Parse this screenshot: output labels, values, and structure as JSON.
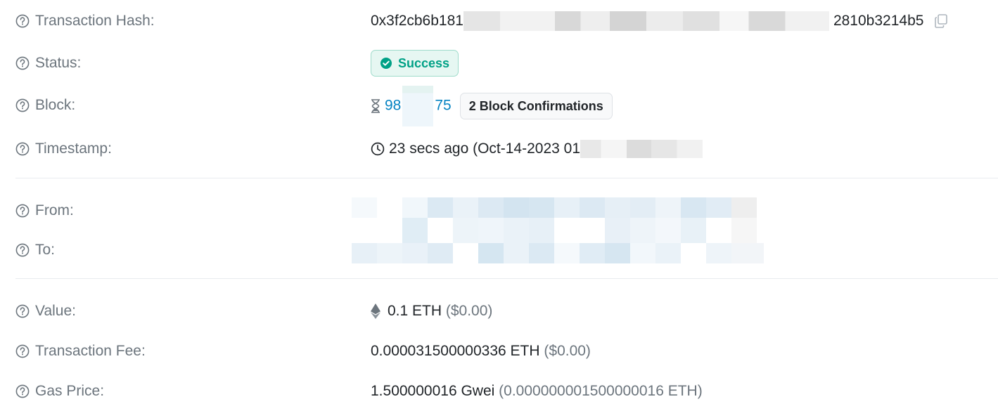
{
  "rows": {
    "hash": {
      "label": "Transaction Hash:",
      "prefix": "0x3f2cb6b181",
      "suffix": "2810b3214b5"
    },
    "status": {
      "label": "Status:",
      "value": "Success"
    },
    "block": {
      "label": "Block:",
      "prefix": "98",
      "suffix": "75",
      "confirmations": "2 Block Confirmations"
    },
    "timestamp": {
      "label": "Timestamp:",
      "value": "23 secs ago (Oct-14-2023 01"
    },
    "from": {
      "label": "From:"
    },
    "to": {
      "label": "To:"
    },
    "value": {
      "label": "Value:",
      "amount": "0.1 ETH",
      "usd": "($0.00)"
    },
    "fee": {
      "label": "Transaction Fee:",
      "amount": "0.000031500000336 ETH",
      "usd": "($0.00)"
    },
    "gas": {
      "label": "Gas Price:",
      "amount": "1.500000016 Gwei",
      "eth": "(0.000000001500000016 ETH)"
    }
  },
  "colors": {
    "label": "#6c757d",
    "link": "#0784c3",
    "success": "#00a186"
  }
}
